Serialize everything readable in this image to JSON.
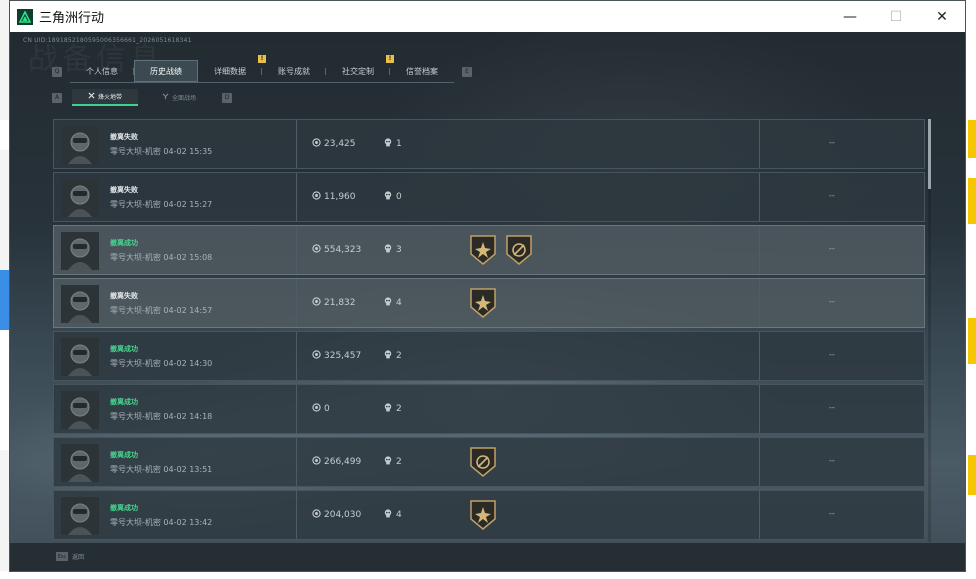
{
  "window": {
    "title": "三角洲行动",
    "buttons": {
      "minimize": "—",
      "maximize": "☐",
      "close": "✕"
    }
  },
  "uid": "CN UID:1891852180595006356661_2026051618341",
  "watermark": "战备信息",
  "tabs": {
    "prev_key": "Q",
    "next_key": "E",
    "items": [
      {
        "label": "个人信息"
      },
      {
        "label": "历史战绩"
      },
      {
        "label": "详细数据"
      },
      {
        "label": "账号成就"
      },
      {
        "label": "社交定制"
      },
      {
        "label": "信誉档案"
      }
    ],
    "alert_mark": "!"
  },
  "subtabs": {
    "prev_key": "A",
    "next_key": "D",
    "items": [
      {
        "label": "烽火地带"
      },
      {
        "label": "全面战场"
      }
    ]
  },
  "records": [
    {
      "result": "撤离失败",
      "success": false,
      "map_time": "零号大坝-机密 04-02 15:35",
      "money": "23,425",
      "kills": "1",
      "badges": [],
      "extra": "--"
    },
    {
      "result": "撤离失败",
      "success": false,
      "map_time": "零号大坝-机密 04-02 15:27",
      "money": "11,960",
      "kills": "0",
      "badges": [],
      "extra": "--"
    },
    {
      "result": "撤离成功",
      "success": true,
      "map_time": "零号大坝-机密 04-02 15:08",
      "money": "554,323",
      "kills": "3",
      "badges": [
        "star-badge",
        "compass-badge"
      ],
      "extra": "--"
    },
    {
      "result": "撤离失败",
      "success": false,
      "map_time": "零号大坝-机密 04-02 14:57",
      "money": "21,832",
      "kills": "4",
      "badges": [
        "star-badge"
      ],
      "extra": "--"
    },
    {
      "result": "撤离成功",
      "success": true,
      "map_time": "零号大坝-机密 04-02 14:30",
      "money": "325,457",
      "kills": "2",
      "badges": [],
      "extra": "--"
    },
    {
      "result": "撤离成功",
      "success": true,
      "map_time": "零号大坝-机密 04-02 14:18",
      "money": "0",
      "kills": "2",
      "badges": [],
      "extra": "--"
    },
    {
      "result": "撤离成功",
      "success": true,
      "map_time": "零号大坝-机密 04-02 13:51",
      "money": "266,499",
      "kills": "2",
      "badges": [
        "compass-badge"
      ],
      "extra": "--"
    },
    {
      "result": "撤离成功",
      "success": true,
      "map_time": "零号大坝-机密 04-02 13:42",
      "money": "204,030",
      "kills": "4",
      "badges": [
        "star-badge"
      ],
      "extra": "--"
    }
  ],
  "footer": {
    "esc_key": "Esc",
    "back_label": "返回"
  },
  "colors": {
    "success": "#46d68f",
    "accent": "#3fd18e",
    "alert": "#e6c04a"
  }
}
